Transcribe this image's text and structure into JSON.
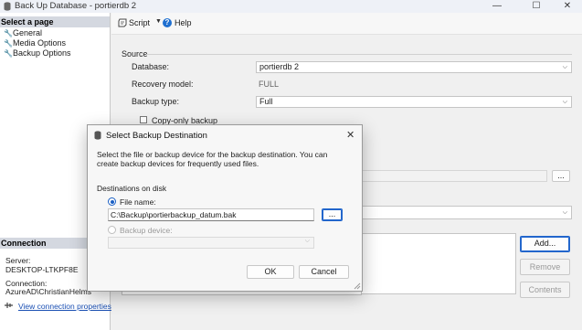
{
  "window": {
    "title": "Back Up Database - portierdb 2",
    "minimize": "—",
    "maximize": "☐",
    "close": "✕"
  },
  "left_panel": {
    "select_page_header": "Select a page",
    "pages": [
      {
        "label": "General"
      },
      {
        "label": "Media Options"
      },
      {
        "label": "Backup Options"
      }
    ],
    "connection_header": "Connection",
    "server_label": "Server:",
    "server_value": "DESKTOP-LTKPF8E",
    "connection_label": "Connection:",
    "connection_value": "AzureAD\\ChristianHelms",
    "view_connection_link": "View connection properties"
  },
  "toolbar": {
    "script_label": "Script",
    "help_label": "Help"
  },
  "main": {
    "source_section": "Source",
    "database_label": "Database:",
    "database_value": "portierdb 2",
    "recovery_model_label": "Recovery model:",
    "recovery_model_value": "FULL",
    "backup_type_label": "Backup type:",
    "backup_type_value": "Full",
    "copy_only_label": "Copy-only backup",
    "browse_label": "...",
    "add_button": "Add...",
    "remove_button": "Remove",
    "contents_button": "Contents"
  },
  "dialog": {
    "title": "Select Backup Destination",
    "description": "Select the file or backup device for the backup destination. You can create backup devices for frequently used files.",
    "destinations_label": "Destinations on disk",
    "file_name_label": "File name:",
    "file_name_value": "C:\\Backup\\portierbackup_datum.bak",
    "browse_button": "...",
    "backup_device_label": "Backup device:",
    "backup_device_value": "",
    "ok_button": "OK",
    "cancel_button": "Cancel",
    "close": "✕"
  }
}
